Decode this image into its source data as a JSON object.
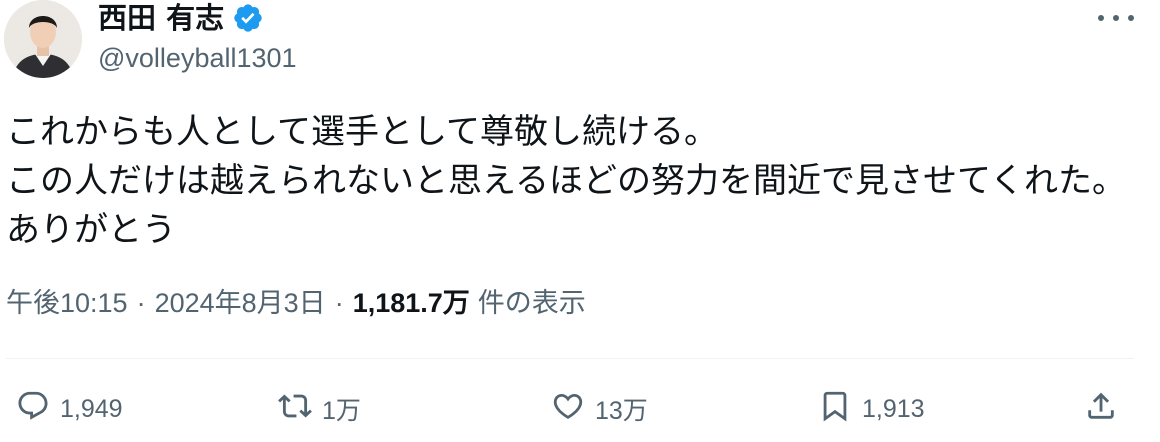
{
  "author": {
    "name": "西田 有志",
    "handle": "@volleyball1301",
    "verified": true
  },
  "tweet": {
    "text": "これからも人として選手として尊敬し続ける。\nこの人だけは越えられないと思えるほどの努力を間近で見させてくれた。\nありがとう",
    "time": "午後10:15",
    "separator": "·",
    "date": "2024年8月3日",
    "views_count": "1,181.7万",
    "views_label": "件の表示"
  },
  "actions": {
    "reply_count": "1,949",
    "retweet_count": "1万",
    "like_count": "13万",
    "bookmark_count": "1,913"
  },
  "colors": {
    "verified_badge": "#1d9bf0",
    "secondary_text": "#536471",
    "primary_text": "#0f1419"
  }
}
